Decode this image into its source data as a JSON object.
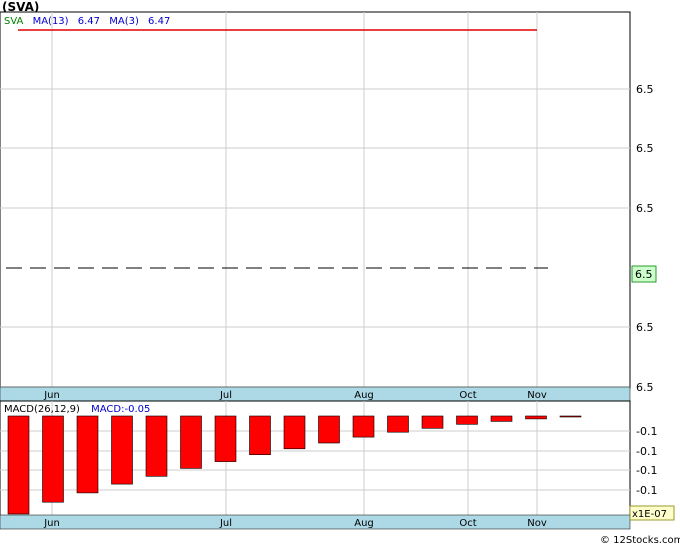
{
  "title": "(SVA)",
  "watermark": "© 12Stocks.com",
  "chart_data": [
    {
      "type": "line",
      "panel": "price",
      "legend": {
        "ticker": "SVA",
        "ma13_label": "MA(13)",
        "ma13_value": "6.47",
        "ma3_label": "MA(3)",
        "ma3_value": "6.47"
      },
      "x_labels": [
        "Jun",
        "Jul",
        "Aug",
        "Oct",
        "Nov"
      ],
      "y_tick_labels": [
        "6.5",
        "6.5",
        "6.5",
        "6.5",
        "6.5"
      ],
      "last_price_label": "6.5",
      "series": [
        {
          "name": "SVA",
          "values": [
            6.47,
            6.47
          ]
        },
        {
          "name": "MA(13)",
          "values": [
            6.47,
            6.47
          ]
        },
        {
          "name": "MA(3)",
          "values": [
            6.47,
            6.47
          ]
        }
      ],
      "reference_line": 6.47,
      "grid": true,
      "colors": {
        "price": "#e00000",
        "ma13": "#0000cc",
        "ma3": "#cc00cc",
        "ticker": "#008000",
        "last_price_bg": "#ccffcc",
        "axis_band": "#add8e6"
      }
    },
    {
      "type": "bar",
      "panel": "macd",
      "legend": {
        "label": "MACD(26,12,9)",
        "value_label": "MACD:-0.05"
      },
      "x_labels": [
        "Jun",
        "Jul",
        "Aug",
        "Oct",
        "Nov"
      ],
      "y_tick_labels": [
        "-0.1",
        "-0.1",
        "-0.1",
        "-0.1"
      ],
      "multiplier_label": "x1E-07",
      "values": [
        -1.0,
        -0.88,
        -0.785,
        -0.695,
        -0.615,
        -0.535,
        -0.465,
        -0.395,
        -0.335,
        -0.275,
        -0.215,
        -0.165,
        -0.125,
        -0.085,
        -0.055,
        -0.03,
        -0.01
      ],
      "ylim": [
        -1.0,
        0.0
      ],
      "grid": true,
      "colors": {
        "bar": "#ff0000",
        "label": "#000000",
        "value": "#0000cc"
      }
    }
  ]
}
